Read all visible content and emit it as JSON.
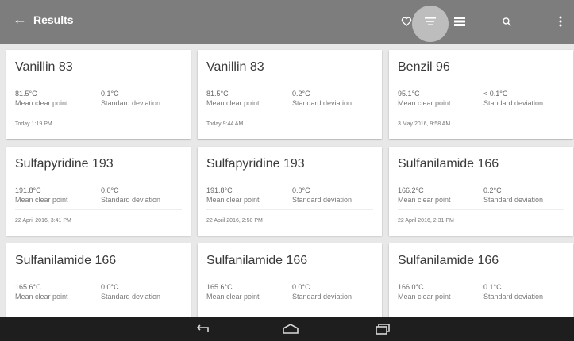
{
  "appbar": {
    "back_icon": "arrow-left-icon",
    "title": "Results",
    "actions": [
      "favorite-icon",
      "filter-list-icon",
      "view-list-icon",
      "search-icon",
      "more-vertical-icon"
    ]
  },
  "cards": [
    {
      "name": "Vanillin 83",
      "mean": "81.5°C",
      "std": "0.1°C",
      "mean_label": "Mean clear point",
      "std_label": "Standard deviation",
      "timestamp": "Today 1:19 PM"
    },
    {
      "name": "Vanillin 83",
      "mean": "81.5°C",
      "std": "0.2°C",
      "mean_label": "Mean clear point",
      "std_label": "Standard deviation",
      "timestamp": "Today 9:44 AM"
    },
    {
      "name": "Benzil 96",
      "mean": "95.1°C",
      "std": "< 0.1°C",
      "mean_label": "Mean clear point",
      "std_label": "Standard deviation",
      "timestamp": "3 May 2016, 9:58 AM"
    },
    {
      "name": "Sulfapyridine 193",
      "mean": "191.8°C",
      "std": "0.0°C",
      "mean_label": "Mean clear point",
      "std_label": "Standard deviation",
      "timestamp": "22 April 2016, 3:41 PM"
    },
    {
      "name": "Sulfapyridine 193",
      "mean": "191.8°C",
      "std": "0.0°C",
      "mean_label": "Mean clear point",
      "std_label": "Standard deviation",
      "timestamp": "22 April 2016, 2:50 PM"
    },
    {
      "name": "Sulfanilamide 166",
      "mean": "166.2°C",
      "std": "0.2°C",
      "mean_label": "Mean clear point",
      "std_label": "Standard deviation",
      "timestamp": "22 April 2016, 2:31 PM"
    },
    {
      "name": "Sulfanilamide 166",
      "mean": "165.6°C",
      "std": "0.0°C",
      "mean_label": "Mean clear point",
      "std_label": "Standard deviation",
      "timestamp": ""
    },
    {
      "name": "Sulfanilamide 166",
      "mean": "165.6°C",
      "std": "0.0°C",
      "mean_label": "Mean clear point",
      "std_label": "Standard deviation",
      "timestamp": ""
    },
    {
      "name": "Sulfanilamide 166",
      "mean": "166.0°C",
      "std": "0.1°C",
      "mean_label": "Mean clear point",
      "std_label": "Standard deviation",
      "timestamp": ""
    }
  ],
  "navbar": {
    "icons": [
      "back-nav-icon",
      "home-nav-icon",
      "recents-nav-icon"
    ]
  },
  "colors": {
    "appbar": "#7d7d7d",
    "background": "#e8e8e8",
    "navbar": "#1e1e1e"
  }
}
